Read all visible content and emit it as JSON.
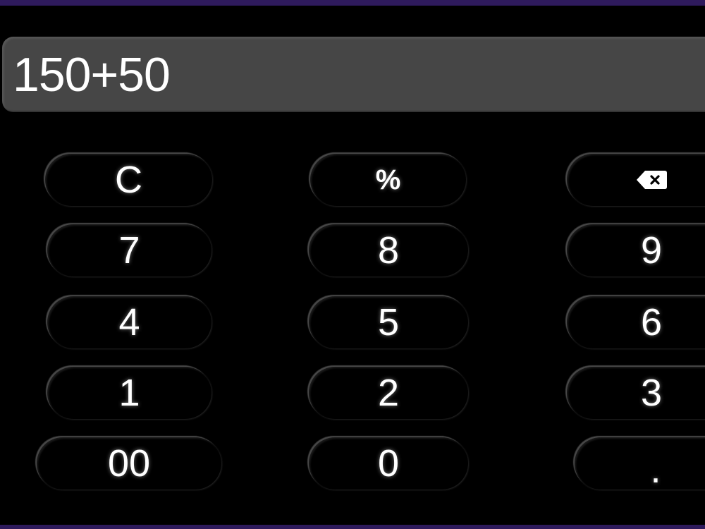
{
  "display": {
    "expression": "150+50"
  },
  "keys": {
    "clear": "C",
    "percent": "%",
    "backspace_icon": "backspace-icon",
    "seven": "7",
    "eight": "8",
    "nine": "9",
    "four": "4",
    "five": "5",
    "six": "6",
    "one": "1",
    "two": "2",
    "three": "3",
    "double_zero": "00",
    "zero": "0",
    "decimal": "."
  },
  "colors": {
    "background": "#000000",
    "display_bg": "#464646",
    "accent": "#2e1a5c",
    "text": "#ffffff"
  }
}
